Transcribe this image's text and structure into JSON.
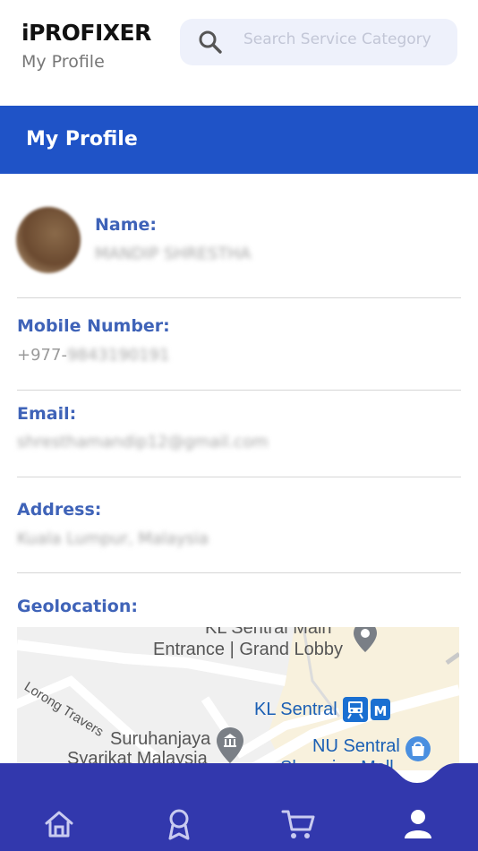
{
  "app": {
    "brand": "iPROFIXER",
    "page_subtitle": "My Profile"
  },
  "search": {
    "placeholder": "Search Service Category",
    "icon": "search-icon"
  },
  "header": {
    "title": "My Profile"
  },
  "profile": {
    "name_label": "Name:",
    "name_value": "MANDIP SHRESTHA",
    "mobile_label": "Mobile Number:",
    "mobile_prefix": "+977-",
    "mobile_value": "9843190191",
    "email_label": "Email:",
    "email_value": "shresthamandip12@gmail.com",
    "address_label": "Address:",
    "address_value": "Kuala Lumpur, Malaysia",
    "geolocation_label": "Geolocation:"
  },
  "map": {
    "labels": {
      "kl_sentral_main": "KL Sentral Main",
      "entrance": "Entrance | Grand Lobby",
      "lorong": "Lorong Travers",
      "kl_sentral": "KL Sentral",
      "suruhanjaya": "Suruhanjaya",
      "syarikat": "Syarikat Malaysia",
      "nu_sentral": "NU Sentral",
      "shopping": "Shopping Mall"
    }
  },
  "nav": {
    "items": [
      "home-icon",
      "award-icon",
      "cart-icon",
      "profile-icon"
    ],
    "active": "profile-icon",
    "bar_color": "#3238ad",
    "icon_color": "#c9cbf0"
  },
  "colors": {
    "header_band": "#1f53c7",
    "label": "#3f63b8"
  }
}
